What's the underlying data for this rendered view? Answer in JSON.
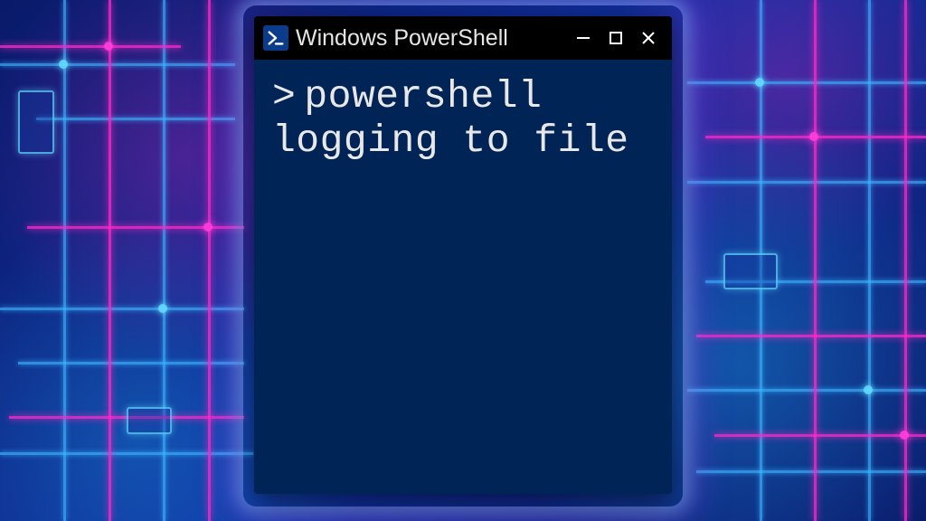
{
  "window": {
    "title": "Windows PowerShell",
    "icon": "powershell-icon"
  },
  "controls": {
    "minimize": "minimize-icon",
    "maximize": "maximize-icon",
    "close": "close-icon"
  },
  "console": {
    "prompt": ">",
    "command": "powershell logging to file"
  },
  "colors": {
    "terminal_bg": "#012456",
    "titlebar_bg": "#000000",
    "text": "#e8e8e8",
    "accent_cyan": "#3cb4ff",
    "accent_magenta": "#ff28c8"
  }
}
